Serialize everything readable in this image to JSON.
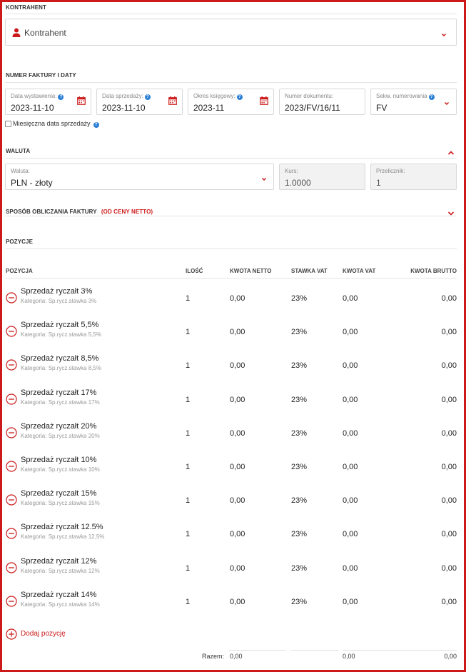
{
  "contractor": {
    "section_title": "KONTRAHENT",
    "placeholder": "Kontrahent"
  },
  "invoice": {
    "section_title": "NUMER FAKTURY I DATY",
    "fields": [
      {
        "label": "Data wystawienia:",
        "value": "2023-11-10",
        "help": true,
        "icon": "calendar-icon"
      },
      {
        "label": "Data sprzedaży:",
        "value": "2023-11-10",
        "help": true,
        "icon": "calendar-icon"
      },
      {
        "label": "Okres księgowy:",
        "value": "2023-11",
        "help": true,
        "icon": "calendar-icon"
      },
      {
        "label": "Numer dokumentu:",
        "value": "2023/FV/16/11",
        "help": false,
        "icon": ""
      },
      {
        "label": "Sekw. numerowania",
        "value": "FV",
        "help": true,
        "icon": "chevron-down-icon"
      }
    ],
    "monthly_checkbox_label": "Miesięczna data sprzedaży",
    "monthly_checked": false
  },
  "currency": {
    "section_title": "WALUTA",
    "currency_label": "Waluta:",
    "currency_value": "PLN - złoty",
    "rate_label": "Kurs:",
    "rate_value": "1.0000",
    "multiplier_label": "Przelicznik:",
    "multiplier_value": "1"
  },
  "calc_method": {
    "section_title": "SPOSÓB OBLICZANIA FAKTURY",
    "mode": "(OD CENY NETTO)"
  },
  "positions": {
    "section_title": "POZYCJE",
    "headers": {
      "position": "POZYCJA",
      "qty": "ILOŚĆ",
      "net": "KWOTA NETTO",
      "vat_rate": "STAWKA VAT",
      "vat_amount": "KWOTA VAT",
      "gross": "KWOTA BRUTTO"
    },
    "items": [
      {
        "name": "Sprzedaż ryczałt 3%",
        "category": "Kategoria: Sp.rycz.stawka 3%",
        "qty": "1",
        "net": "0,00",
        "vat_rate": "23%",
        "vat_amount": "0,00",
        "gross": "0,00"
      },
      {
        "name": "Sprzedaż ryczałt 5,5%",
        "category": "Kategoria: Sp.rycz.stawka 5,5%",
        "qty": "1",
        "net": "0,00",
        "vat_rate": "23%",
        "vat_amount": "0,00",
        "gross": "0,00"
      },
      {
        "name": "Sprzedaż ryczałt 8,5%",
        "category": "Kategoria: Sp.rycz.stawka 8,5%",
        "qty": "1",
        "net": "0,00",
        "vat_rate": "23%",
        "vat_amount": "0,00",
        "gross": "0,00"
      },
      {
        "name": "Sprzedaż ryczałt 17%",
        "category": "Kategoria: Sp.rycz.stawka 17%",
        "qty": "1",
        "net": "0,00",
        "vat_rate": "23%",
        "vat_amount": "0,00",
        "gross": "0,00"
      },
      {
        "name": "Sprzedaż ryczałt 20%",
        "category": "Kategoria: Sp.rycz.stawka 20%",
        "qty": "1",
        "net": "0,00",
        "vat_rate": "23%",
        "vat_amount": "0,00",
        "gross": "0,00"
      },
      {
        "name": "Sprzedaż ryczałt 10%",
        "category": "Kategoria: Sp.rycz.stawka 10%",
        "qty": "1",
        "net": "0,00",
        "vat_rate": "23%",
        "vat_amount": "0,00",
        "gross": "0,00"
      },
      {
        "name": "Sprzedaż ryczałt 15%",
        "category": "Kategoria: Sp.rycz.stawka 15%",
        "qty": "1",
        "net": "0,00",
        "vat_rate": "23%",
        "vat_amount": "0,00",
        "gross": "0,00"
      },
      {
        "name": "Sprzedaż ryczałt 12.5%",
        "category": "Kategoria: Sp.rycz.stawka 12,5%",
        "qty": "1",
        "net": "0,00",
        "vat_rate": "23%",
        "vat_amount": "0,00",
        "gross": "0,00"
      },
      {
        "name": "Sprzedaż ryczałt 12%",
        "category": "Kategoria: Sp.rycz.stawka 12%",
        "qty": "1",
        "net": "0,00",
        "vat_rate": "23%",
        "vat_amount": "0,00",
        "gross": "0,00"
      },
      {
        "name": "Sprzedaż ryczałt 14%",
        "category": "Kategoria: Sp.rycz.stawka 14%",
        "qty": "1",
        "net": "0,00",
        "vat_rate": "23%",
        "vat_amount": "0,00",
        "gross": "0,00"
      }
    ],
    "add_label": "Dodaj pozycję",
    "totals": {
      "label": "Razem:",
      "net": "0,00",
      "vat_amount": "0,00",
      "gross": "0,00"
    }
  },
  "colors": {
    "accent": "#cc1a1a",
    "help": "#2b7fd4"
  }
}
